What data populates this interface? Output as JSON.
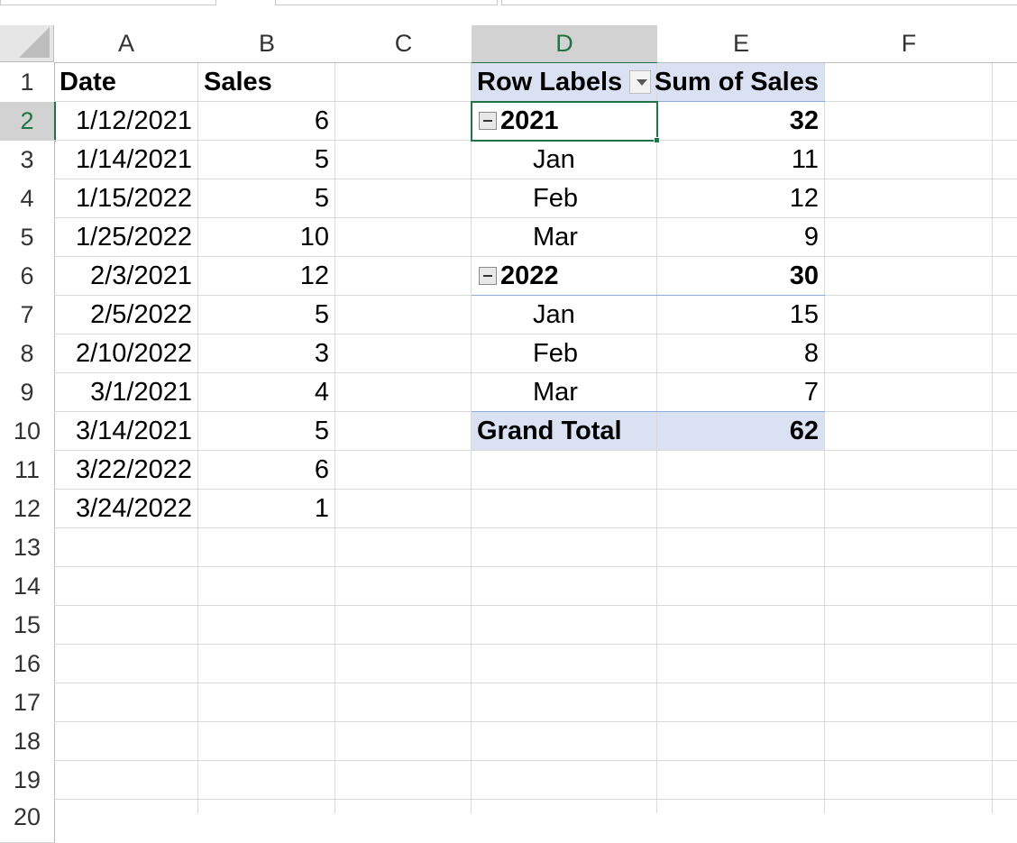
{
  "columns": [
    "A",
    "B",
    "C",
    "D",
    "E",
    "F"
  ],
  "rows": [
    "1",
    "2",
    "3",
    "4",
    "5",
    "6",
    "7",
    "8",
    "9",
    "10",
    "11",
    "12",
    "13",
    "14",
    "15",
    "16",
    "17",
    "18",
    "19",
    "20"
  ],
  "data_table": {
    "headers": {
      "date": "Date",
      "sales": "Sales"
    },
    "rows": [
      {
        "date": "1/12/2021",
        "sales": "6"
      },
      {
        "date": "1/14/2021",
        "sales": "5"
      },
      {
        "date": "1/15/2022",
        "sales": "5"
      },
      {
        "date": "1/25/2022",
        "sales": "10"
      },
      {
        "date": "2/3/2021",
        "sales": "12"
      },
      {
        "date": "2/5/2022",
        "sales": "5"
      },
      {
        "date": "2/10/2022",
        "sales": "3"
      },
      {
        "date": "3/1/2021",
        "sales": "4"
      },
      {
        "date": "3/14/2021",
        "sales": "5"
      },
      {
        "date": "3/22/2022",
        "sales": "6"
      },
      {
        "date": "3/24/2022",
        "sales": "1"
      }
    ]
  },
  "pivot": {
    "row_labels_header": "Row Labels",
    "value_header": "Sum of Sales",
    "groups": [
      {
        "year": "2021",
        "total": "32",
        "months": [
          {
            "label": "Jan",
            "value": "11"
          },
          {
            "label": "Feb",
            "value": "12"
          },
          {
            "label": "Mar",
            "value": "9"
          }
        ]
      },
      {
        "year": "2022",
        "total": "30",
        "months": [
          {
            "label": "Jan",
            "value": "15"
          },
          {
            "label": "Feb",
            "value": "8"
          },
          {
            "label": "Mar",
            "value": "7"
          }
        ]
      }
    ],
    "grand_total_label": "Grand Total",
    "grand_total_value": "62"
  },
  "selection": {
    "active_cell": "D2",
    "active_column": "D",
    "active_row": "2"
  },
  "colors": {
    "accent": "#217346",
    "pivot_header_bg": "#d9e1f2"
  },
  "icons": {
    "corner": "select-all-triangle-icon",
    "filter": "filter-dropdown-icon",
    "collapse": "collapse-minus-icon"
  }
}
